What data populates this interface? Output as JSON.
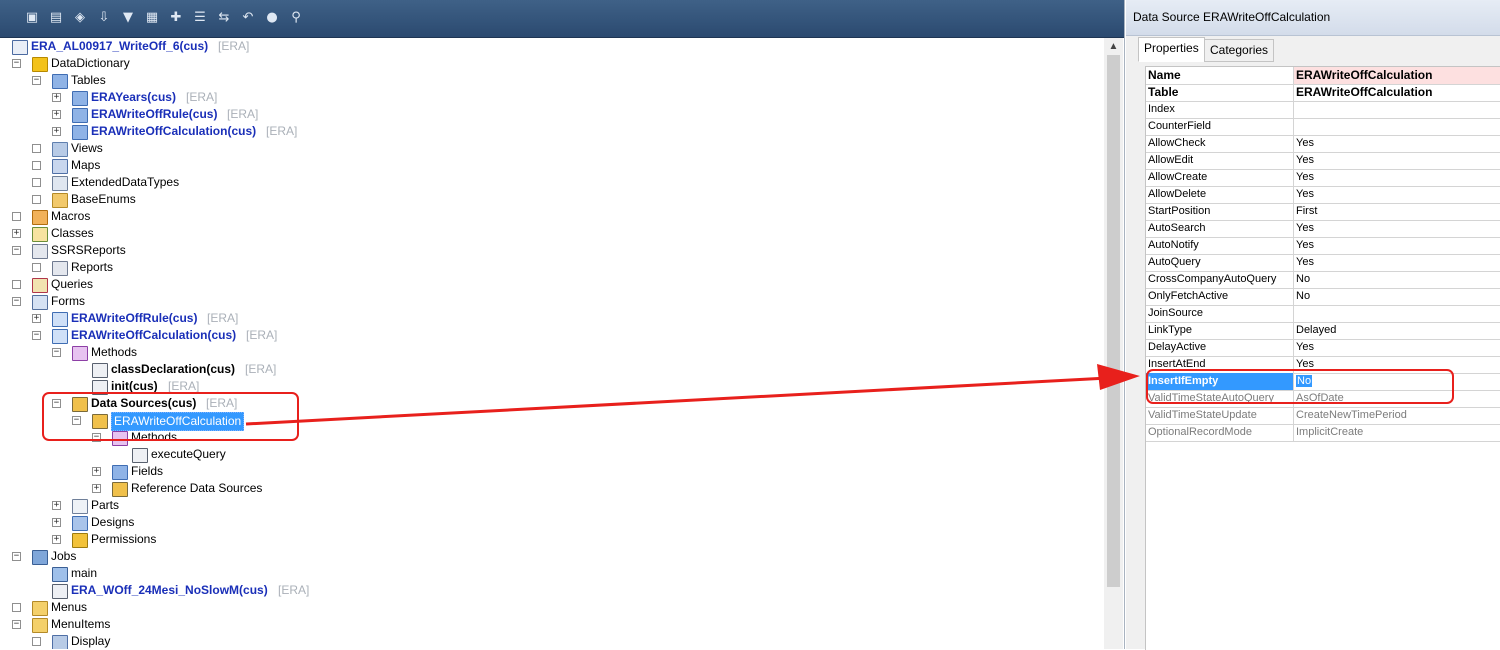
{
  "toolbar": {
    "buttons": [
      "open-icon",
      "save-icon",
      "compile-icon",
      "import-icon",
      "filter-icon",
      "grid-icon",
      "new-icon",
      "properties-icon",
      "compare-icon",
      "undo-icon",
      "refresh-icon",
      "find-icon"
    ]
  },
  "tree": {
    "root": {
      "label": "ERA_AL00917_WriteOff_6(cus)",
      "tag": "[ERA]"
    },
    "data_dictionary": "DataDictionary",
    "tables": "Tables",
    "table_items": [
      {
        "label": "ERAYears(cus)",
        "tag": "[ERA]"
      },
      {
        "label": "ERAWriteOffRule(cus)",
        "tag": "[ERA]"
      },
      {
        "label": "ERAWriteOffCalculation(cus)",
        "tag": "[ERA]"
      }
    ],
    "views": "Views",
    "maps": "Maps",
    "extended_data_types": "ExtendedDataTypes",
    "base_enums": "BaseEnums",
    "macros": "Macros",
    "classes": "Classes",
    "ssrs_reports": "SSRSReports",
    "reports": "Reports",
    "queries": "Queries",
    "forms": "Forms",
    "form_rule": {
      "label": "ERAWriteOffRule(cus)",
      "tag": "[ERA]"
    },
    "form_calc": {
      "label": "ERAWriteOffCalculation(cus)",
      "tag": "[ERA]"
    },
    "methods": "Methods",
    "class_declaration": {
      "label": "classDeclaration(cus)",
      "tag": "[ERA]"
    },
    "init": {
      "label": "init(cus)",
      "tag": "[ERA]"
    },
    "data_sources": {
      "label": "Data Sources(cus)",
      "tag": "[ERA]"
    },
    "selected_ds": "ERAWriteOffCalculation",
    "ds_methods": "Methods",
    "execute_query": "executeQuery",
    "fields": "Fields",
    "reference_ds": "Reference Data Sources",
    "parts": "Parts",
    "designs": "Designs",
    "permissions": "Permissions",
    "jobs": "Jobs",
    "main": "main",
    "job_item": {
      "label": "ERA_WOff_24Mesi_NoSlowM(cus)",
      "tag": "[ERA]"
    },
    "menus": "Menus",
    "menu_items": "MenuItems",
    "display": "Display"
  },
  "props": {
    "title": "Data Source ERAWriteOffCalculation",
    "tabs": [
      "Properties",
      "Categories"
    ],
    "rows": [
      {
        "name": "Name",
        "value": "ERAWriteOffCalculation"
      },
      {
        "name": "Table",
        "value": "ERAWriteOffCalculation"
      },
      {
        "name": "Index",
        "value": ""
      },
      {
        "name": "CounterField",
        "value": ""
      },
      {
        "name": "AllowCheck",
        "value": "Yes"
      },
      {
        "name": "AllowEdit",
        "value": "Yes"
      },
      {
        "name": "AllowCreate",
        "value": "Yes"
      },
      {
        "name": "AllowDelete",
        "value": "Yes"
      },
      {
        "name": "StartPosition",
        "value": "First"
      },
      {
        "name": "AutoSearch",
        "value": "Yes"
      },
      {
        "name": "AutoNotify",
        "value": "Yes"
      },
      {
        "name": "AutoQuery",
        "value": "Yes"
      },
      {
        "name": "CrossCompanyAutoQuery",
        "value": "No"
      },
      {
        "name": "OnlyFetchActive",
        "value": "No"
      },
      {
        "name": "JoinSource",
        "value": ""
      },
      {
        "name": "LinkType",
        "value": "Delayed"
      },
      {
        "name": "DelayActive",
        "value": "Yes"
      },
      {
        "name": "InsertAtEnd",
        "value": "Yes"
      },
      {
        "name": "InsertIfEmpty",
        "value": "No"
      },
      {
        "name": "ValidTimeStateAutoQuery",
        "value": "AsOfDate"
      },
      {
        "name": "ValidTimeStateUpdate",
        "value": "CreateNewTimePeriod"
      },
      {
        "name": "OptionalRecordMode",
        "value": "ImplicitCreate"
      }
    ]
  },
  "colors": {
    "annotation": "#e8201c",
    "selection": "#3399ff",
    "object_blue": "#1a2fb8"
  }
}
